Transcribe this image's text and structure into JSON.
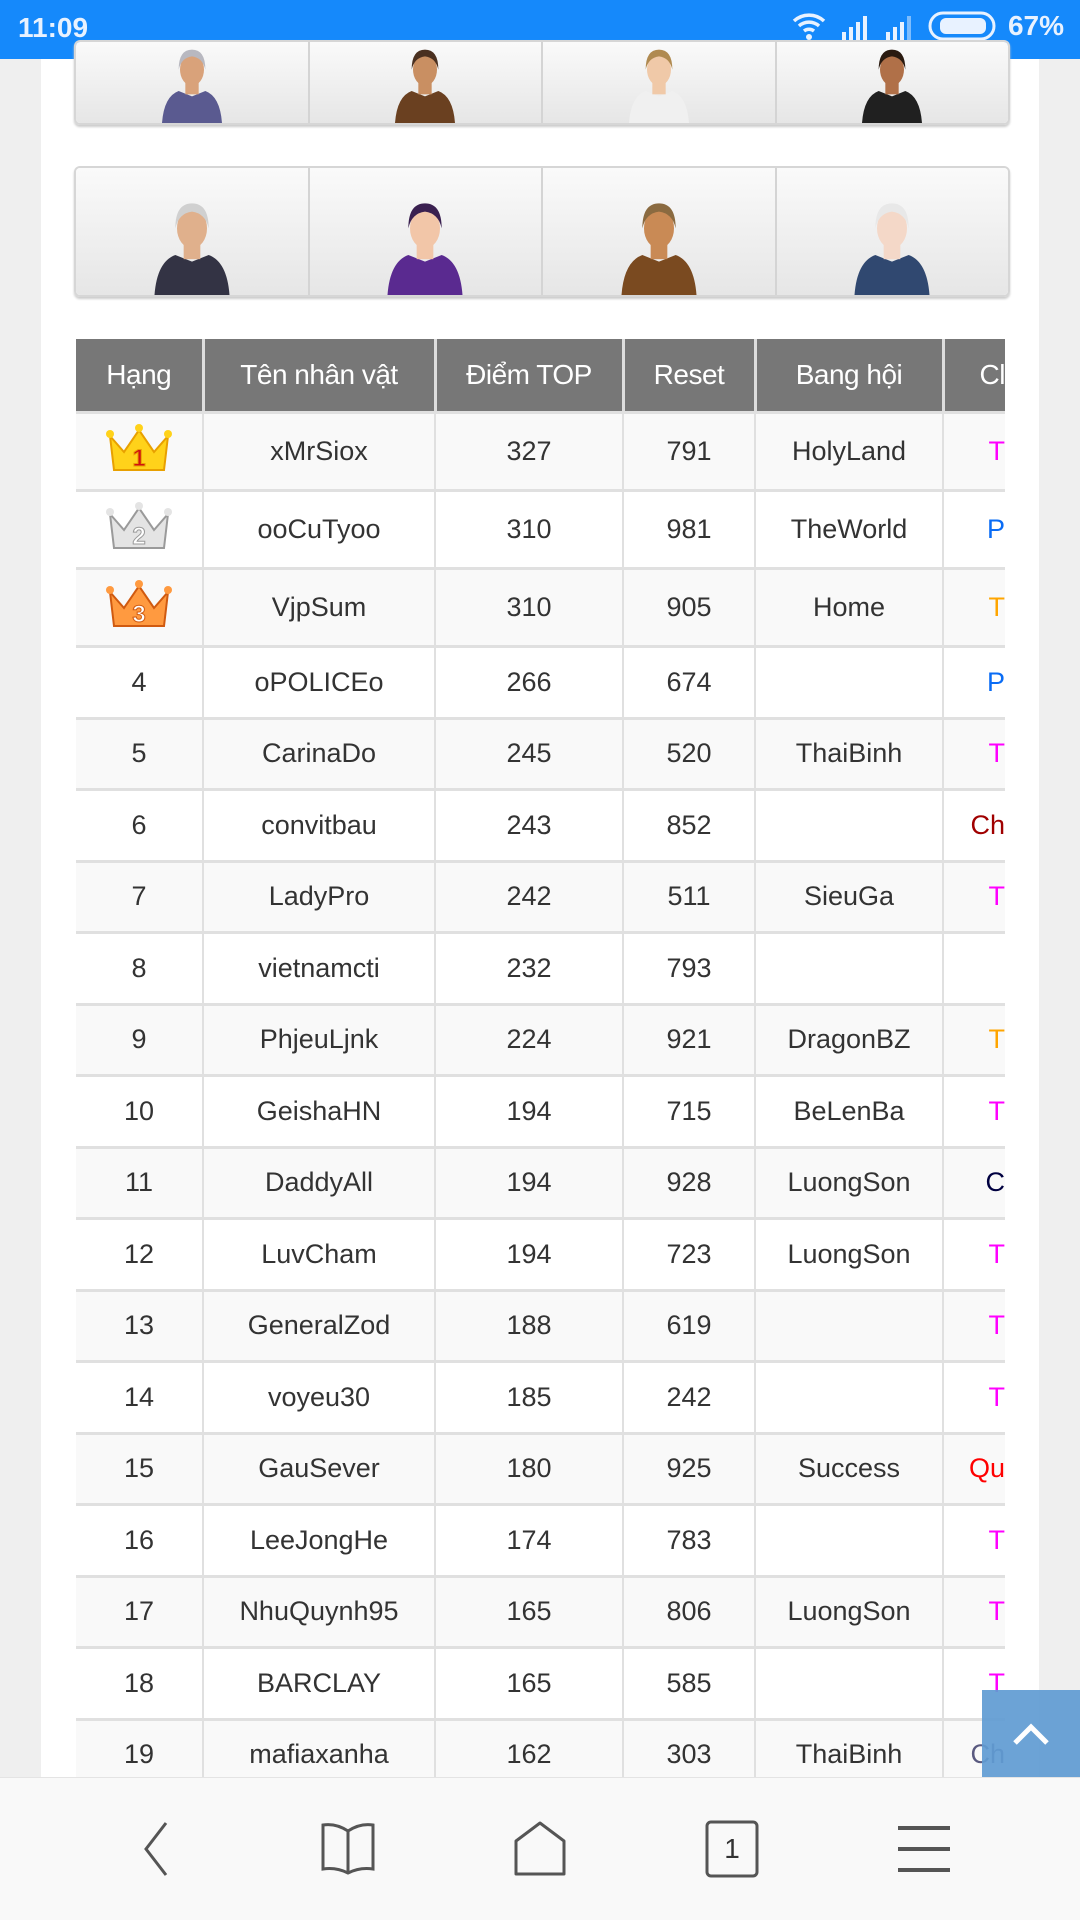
{
  "status_bar": {
    "time": "11:09",
    "battery": "67%",
    "icons": [
      "wifi-icon",
      "signal-icon",
      "signal-icon",
      "battery-icon"
    ]
  },
  "character_classes": {
    "row1": [
      "class-avatar-1",
      "class-avatar-2",
      "class-avatar-3",
      "class-avatar-4"
    ],
    "row2": [
      "class-avatar-5",
      "class-avatar-6",
      "class-avatar-7",
      "class-avatar-8"
    ]
  },
  "table": {
    "headers": [
      "Hạng",
      "Tên nhân vật",
      "Điểm TOP",
      "Reset",
      "Bang hội",
      "Cl"
    ],
    "rows": [
      {
        "rank": "1",
        "crown": "gold",
        "name": "xMrSiox",
        "score": "327",
        "reset": "791",
        "guild": "HolyLand",
        "cls": "T",
        "cls_color": "#ff00ff"
      },
      {
        "rank": "2",
        "crown": "silver",
        "name": "ooCuTyoo",
        "score": "310",
        "reset": "981",
        "guild": "TheWorld",
        "cls": "P",
        "cls_color": "#0a6cf5"
      },
      {
        "rank": "3",
        "crown": "bronze",
        "name": "VjpSum",
        "score": "310",
        "reset": "905",
        "guild": "Home",
        "cls": "T",
        "cls_color": "#ffa500"
      },
      {
        "rank": "4",
        "name": "oPOLICEo",
        "score": "266",
        "reset": "674",
        "guild": "",
        "cls": "P",
        "cls_color": "#0a6cf5"
      },
      {
        "rank": "5",
        "name": "CarinaDo",
        "score": "245",
        "reset": "520",
        "guild": "ThaiBinh",
        "cls": "T",
        "cls_color": "#ff00ff"
      },
      {
        "rank": "6",
        "name": "convitbau",
        "score": "243",
        "reset": "852",
        "guild": "",
        "cls": "Ch",
        "cls_color": "#a00000"
      },
      {
        "rank": "7",
        "name": "LadyPro",
        "score": "242",
        "reset": "511",
        "guild": "SieuGa",
        "cls": "T",
        "cls_color": "#ff00ff"
      },
      {
        "rank": "8",
        "name": "vietnamcti",
        "score": "232",
        "reset": "793",
        "guild": "",
        "cls": "",
        "cls_color": "#333333"
      },
      {
        "rank": "9",
        "name": "PhjeuLjnk",
        "score": "224",
        "reset": "921",
        "guild": "DragonBZ",
        "cls": "T",
        "cls_color": "#ffa500"
      },
      {
        "rank": "10",
        "name": "GeishaHN",
        "score": "194",
        "reset": "715",
        "guild": "BeLenBa",
        "cls": "T",
        "cls_color": "#ff00ff"
      },
      {
        "rank": "11",
        "name": "DaddyAll",
        "score": "194",
        "reset": "928",
        "guild": "LuongSon",
        "cls": "C",
        "cls_color": "#000040"
      },
      {
        "rank": "12",
        "name": "LuvCham",
        "score": "194",
        "reset": "723",
        "guild": "LuongSon",
        "cls": "T",
        "cls_color": "#ff00ff"
      },
      {
        "rank": "13",
        "name": "GeneralZod",
        "score": "188",
        "reset": "619",
        "guild": "",
        "cls": "T",
        "cls_color": "#ff00ff"
      },
      {
        "rank": "14",
        "name": "voyeu30",
        "score": "185",
        "reset": "242",
        "guild": "",
        "cls": "T",
        "cls_color": "#ff00ff"
      },
      {
        "rank": "15",
        "name": "GauSever",
        "score": "180",
        "reset": "925",
        "guild": "Success",
        "cls": "Qu",
        "cls_color": "#ff0000"
      },
      {
        "rank": "16",
        "name": "LeeJongHe",
        "score": "174",
        "reset": "783",
        "guild": "",
        "cls": "T",
        "cls_color": "#ff00ff"
      },
      {
        "rank": "17",
        "name": "NhuQuynh95",
        "score": "165",
        "reset": "806",
        "guild": "LuongSon",
        "cls": "T",
        "cls_color": "#ff00ff"
      },
      {
        "rank": "18",
        "name": "BARCLAY",
        "score": "165",
        "reset": "585",
        "guild": "",
        "cls": "T",
        "cls_color": "#ff00ff"
      },
      {
        "rank": "19",
        "name": "mafiaxanha",
        "score": "162",
        "reset": "303",
        "guild": "ThaiBinh",
        "cls": "Ch",
        "cls_color": "#5a5a80"
      }
    ]
  },
  "bottom_nav": {
    "tab_count": "1",
    "items": [
      "back-icon",
      "bookmarks-icon",
      "home-icon",
      "tabs-icon",
      "menu-icon"
    ]
  }
}
